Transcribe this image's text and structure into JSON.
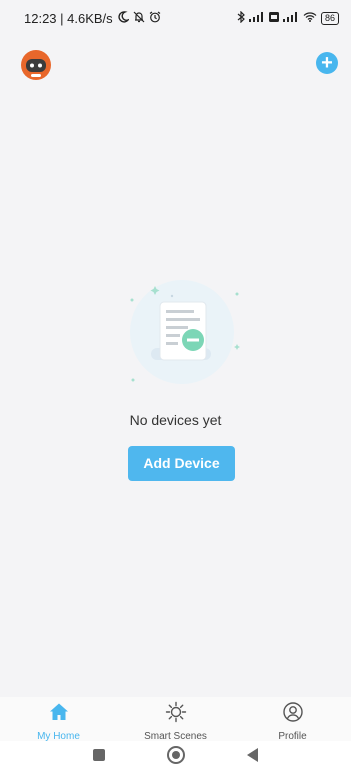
{
  "status_bar": {
    "time_speed": "12:23 | 4.6KB/s",
    "battery": "86"
  },
  "top_bar": {
    "add_label": "+"
  },
  "empty_state": {
    "message": "No devices yet",
    "add_device_label": "Add Device"
  },
  "tabs": [
    {
      "label": "My Home"
    },
    {
      "label": "Smart Scenes"
    },
    {
      "label": "Profile"
    }
  ],
  "colors": {
    "accent": "#48b6ee",
    "button": "#4fb7ee",
    "background": "#f4f4f6"
  },
  "icons": [
    "moon-icon",
    "bell-off-icon",
    "alarm-icon",
    "bluetooth-icon",
    "signal-icon",
    "wifi-icon",
    "battery-icon",
    "avatar-icon",
    "plus-icon",
    "home-icon",
    "sun-icon",
    "user-icon"
  ]
}
